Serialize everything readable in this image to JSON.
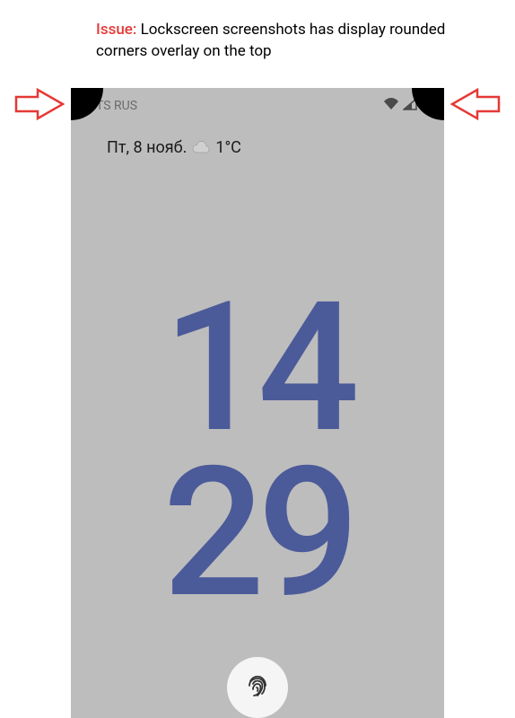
{
  "annotation": {
    "label": "Issue:",
    "text": "Lockscreen screenshots has display rounded corners overlay on the top"
  },
  "statusBar": {
    "carrier": "MTS RUS"
  },
  "dateRow": {
    "date": "Пт, 8 нояб.",
    "temp": "1°C"
  },
  "clock": {
    "line1": "14",
    "line2": "29"
  }
}
